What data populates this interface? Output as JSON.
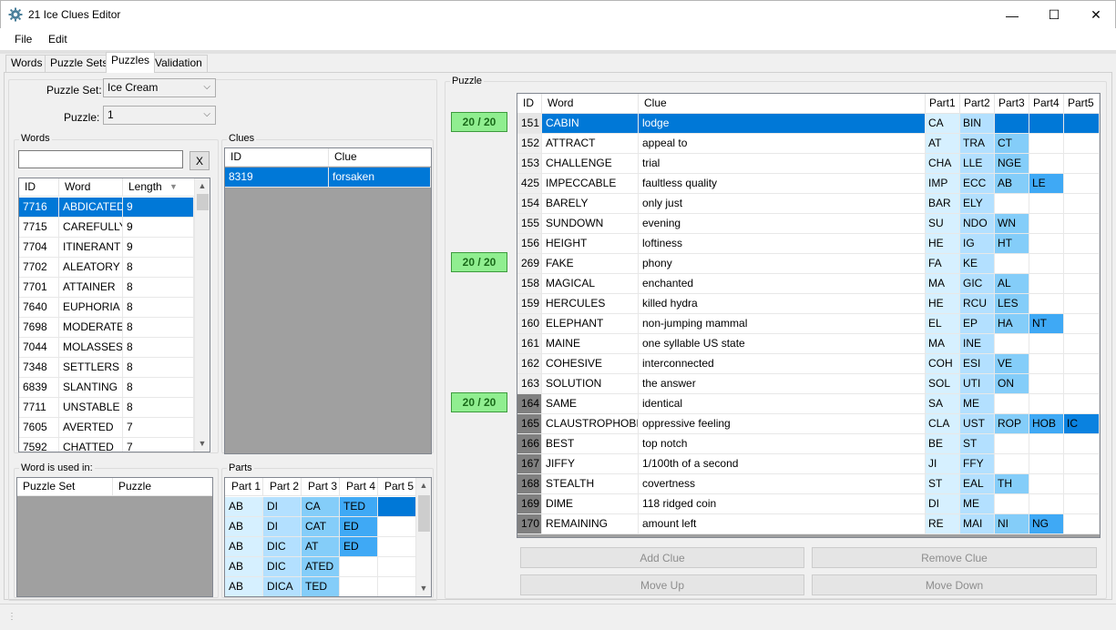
{
  "window": {
    "title": "21 Ice Clues Editor",
    "minimize": "—",
    "maximize": "☐",
    "close": "✕"
  },
  "menu": [
    "File",
    "Edit"
  ],
  "tabs": [
    "Words",
    "Puzzle Sets",
    "Puzzles",
    "Validation"
  ],
  "active_tab": "Puzzles",
  "selectors": {
    "puzzle_set_label": "Puzzle Set:",
    "puzzle_set_value": "Ice Cream",
    "puzzle_label": "Puzzle:",
    "puzzle_value": "1"
  },
  "words_panel": {
    "title": "Words",
    "search_value": "",
    "clear_label": "X",
    "columns": [
      "ID",
      "Word",
      "Length"
    ],
    "rows": [
      [
        "7716",
        "ABDICATED",
        "9"
      ],
      [
        "7715",
        "CAREFULLY",
        "9"
      ],
      [
        "7704",
        "ITINERANT",
        "9"
      ],
      [
        "7702",
        "ALEATORY",
        "8"
      ],
      [
        "7701",
        "ATTAINER",
        "8"
      ],
      [
        "7640",
        "EUPHORIA",
        "8"
      ],
      [
        "7698",
        "MODERATE",
        "8"
      ],
      [
        "7044",
        "MOLASSES",
        "8"
      ],
      [
        "7348",
        "SETTLERS",
        "8"
      ],
      [
        "6839",
        "SLANTING",
        "8"
      ],
      [
        "7711",
        "UNSTABLE",
        "8"
      ],
      [
        "7605",
        "AVERTED",
        "7"
      ],
      [
        "7592",
        "CHATTED",
        "7"
      ]
    ]
  },
  "clues_panel": {
    "title": "Clues",
    "columns": [
      "ID",
      "Clue"
    ],
    "rows": [
      [
        "8319",
        "forsaken"
      ]
    ]
  },
  "used_in_panel": {
    "title": "Word is used in:",
    "columns": [
      "Puzzle Set",
      "Puzzle"
    ]
  },
  "parts_panel": {
    "title": "Parts",
    "columns": [
      "Part 1",
      "Part 2",
      "Part 3",
      "Part 4",
      "Part 5"
    ],
    "rows": [
      [
        "AB",
        "DI",
        "CA",
        "TED",
        ""
      ],
      [
        "AB",
        "DI",
        "CAT",
        "ED",
        ""
      ],
      [
        "AB",
        "DIC",
        "AT",
        "ED",
        ""
      ],
      [
        "AB",
        "DIC",
        "ATED",
        "",
        ""
      ],
      [
        "AB",
        "DICA",
        "TED",
        "",
        ""
      ]
    ]
  },
  "puzzle_panel": {
    "title": "Puzzle",
    "scores": [
      "20 / 20",
      "20 / 20",
      "20 / 20"
    ],
    "columns": [
      "ID",
      "Word",
      "Clue",
      "Part1",
      "Part2",
      "Part3",
      "Part4",
      "Part5"
    ],
    "rows": [
      [
        "151",
        "CABIN",
        "lodge",
        "CA",
        "BIN",
        "",
        "",
        ""
      ],
      [
        "152",
        "ATTRACT",
        "appeal to",
        "AT",
        "TRA",
        "CT",
        "",
        ""
      ],
      [
        "153",
        "CHALLENGE",
        "trial",
        "CHA",
        "LLE",
        "NGE",
        "",
        ""
      ],
      [
        "425",
        "IMPECCABLE",
        "faultless quality",
        "IMP",
        "ECC",
        "AB",
        "LE",
        ""
      ],
      [
        "154",
        "BARELY",
        "only just",
        "BAR",
        "ELY",
        "",
        "",
        ""
      ],
      [
        "155",
        "SUNDOWN",
        "evening",
        "SU",
        "NDO",
        "WN",
        "",
        ""
      ],
      [
        "156",
        "HEIGHT",
        "loftiness",
        "HE",
        "IG",
        "HT",
        "",
        ""
      ],
      [
        "269",
        "FAKE",
        "phony",
        "FA",
        "KE",
        "",
        "",
        ""
      ],
      [
        "158",
        "MAGICAL",
        "enchanted",
        "MA",
        "GIC",
        "AL",
        "",
        ""
      ],
      [
        "159",
        "HERCULES",
        "killed hydra",
        "HE",
        "RCU",
        "LES",
        "",
        ""
      ],
      [
        "160",
        "ELEPHANT",
        "non-jumping mammal",
        "EL",
        "EP",
        "HA",
        "NT",
        ""
      ],
      [
        "161",
        "MAINE",
        "one syllable US state",
        "MA",
        "INE",
        "",
        "",
        ""
      ],
      [
        "162",
        "COHESIVE",
        "interconnected",
        "COH",
        "ESI",
        "VE",
        "",
        ""
      ],
      [
        "163",
        "SOLUTION",
        "the answer",
        "SOL",
        "UTI",
        "ON",
        "",
        ""
      ],
      [
        "164",
        "SAME",
        "identical",
        "SA",
        "ME",
        "",
        "",
        ""
      ],
      [
        "165",
        "CLAUSTROPHOBIC",
        "oppressive feeling",
        "CLA",
        "UST",
        "ROP",
        "HOB",
        "IC"
      ],
      [
        "166",
        "BEST",
        "top notch",
        "BE",
        "ST",
        "",
        "",
        ""
      ],
      [
        "167",
        "JIFFY",
        "1/100th of a second",
        "JI",
        "FFY",
        "",
        "",
        ""
      ],
      [
        "168",
        "STEALTH",
        "covertness",
        "ST",
        "EAL",
        "TH",
        "",
        ""
      ],
      [
        "169",
        "DIME",
        "118 ridged coin",
        "DI",
        "ME",
        "",
        "",
        ""
      ],
      [
        "170",
        "REMAINING",
        "amount left",
        "RE",
        "MAI",
        "NI",
        "NG",
        ""
      ]
    ],
    "buttons": {
      "add": "Add Clue",
      "remove": "Remove Clue",
      "up": "Move Up",
      "down": "Move Down"
    }
  },
  "colors": {
    "selection": "#0078d7",
    "part1": "#d6f0ff",
    "part2": "#b3e0ff",
    "part3": "#84cdf9",
    "part4": "#3fa9f5",
    "part5": "#0a82e0",
    "score_bg": "#90ee90"
  }
}
